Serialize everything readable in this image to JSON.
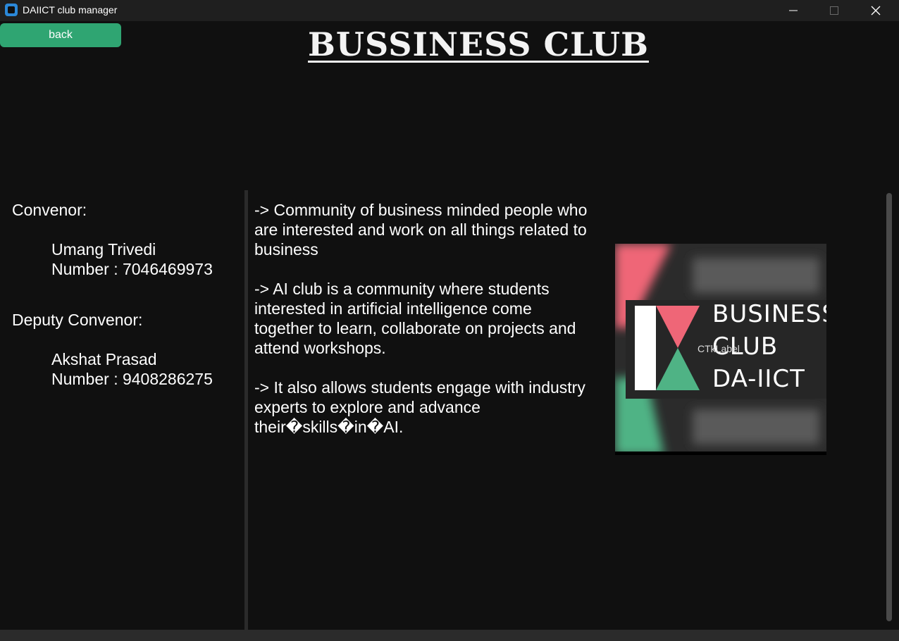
{
  "window": {
    "title": "DAIICT club manager"
  },
  "controls": {
    "back_label": "back"
  },
  "header": {
    "title": "BUSSINESS CLUB"
  },
  "contacts": {
    "convenor_heading": "Convenor:",
    "convenor_name": "Umang Trivedi",
    "convenor_number": "Number : 7046469973",
    "deputy_heading": "Deputy Convenor:",
    "deputy_name": "Akshat Prasad",
    "deputy_number": "Number : 9408286275"
  },
  "description": {
    "paragraphs": [
      "-> Community of business minded people who are interested and work on all things related to business",
      "-> AI club is a community where students interested in artificial intelligence come together to learn, collaborate on projects and attend workshops.",
      "-> It also allows students engage with industry experts to explore and advance their�skills�in�AI."
    ]
  },
  "logo": {
    "line1": "BUSINESS",
    "line2": "CLUB",
    "line3": "DA-IICT",
    "overlay_label": "CTkLabel",
    "colors": {
      "pink": "#ef6677",
      "green": "#4fb385",
      "white": "#ffffff",
      "dark": "#262626"
    }
  },
  "colors": {
    "accent": "#2fa572",
    "background": "#101010",
    "titlebar": "#1f1f1f"
  }
}
